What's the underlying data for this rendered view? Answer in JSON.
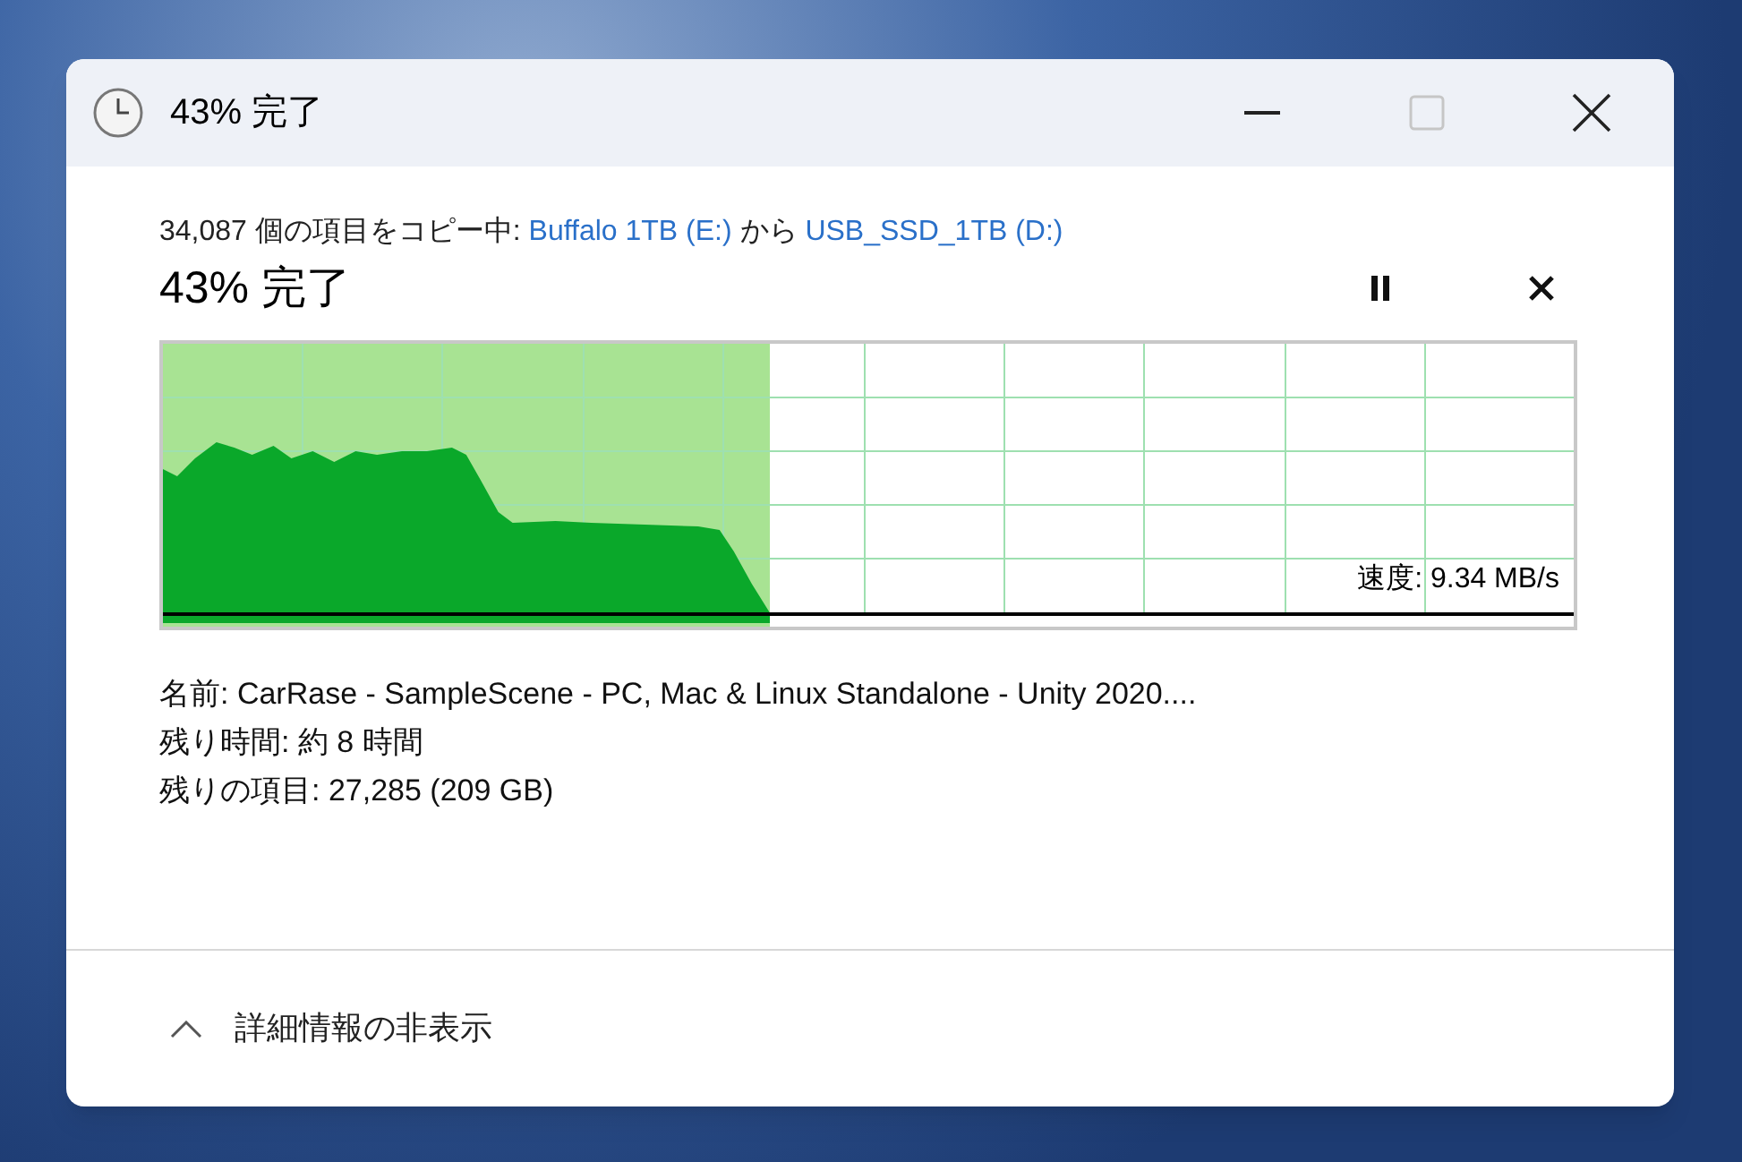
{
  "window": {
    "title": "43% 完了",
    "maximize_enabled": false
  },
  "copy_summary": {
    "text": "34,087 個の項目をコピー中: ",
    "source": "Buffalo 1TB (E:)",
    "connector": " から ",
    "destination": "USB_SSD_1TB (D:)"
  },
  "progress": {
    "heading": "43% 完了",
    "level": 0.43,
    "speed": "速度: 9.34 MB/s"
  },
  "details": [
    "名前: CarRase - SampleScene - PC, Mac & Linux Standalone - Unity 2020....",
    "残り時間: 約 8 時間",
    "残りの項目: 27,285 (209 GB)"
  ],
  "toggle": {
    "label": "詳細情報の非表示",
    "expanded": true
  }
}
